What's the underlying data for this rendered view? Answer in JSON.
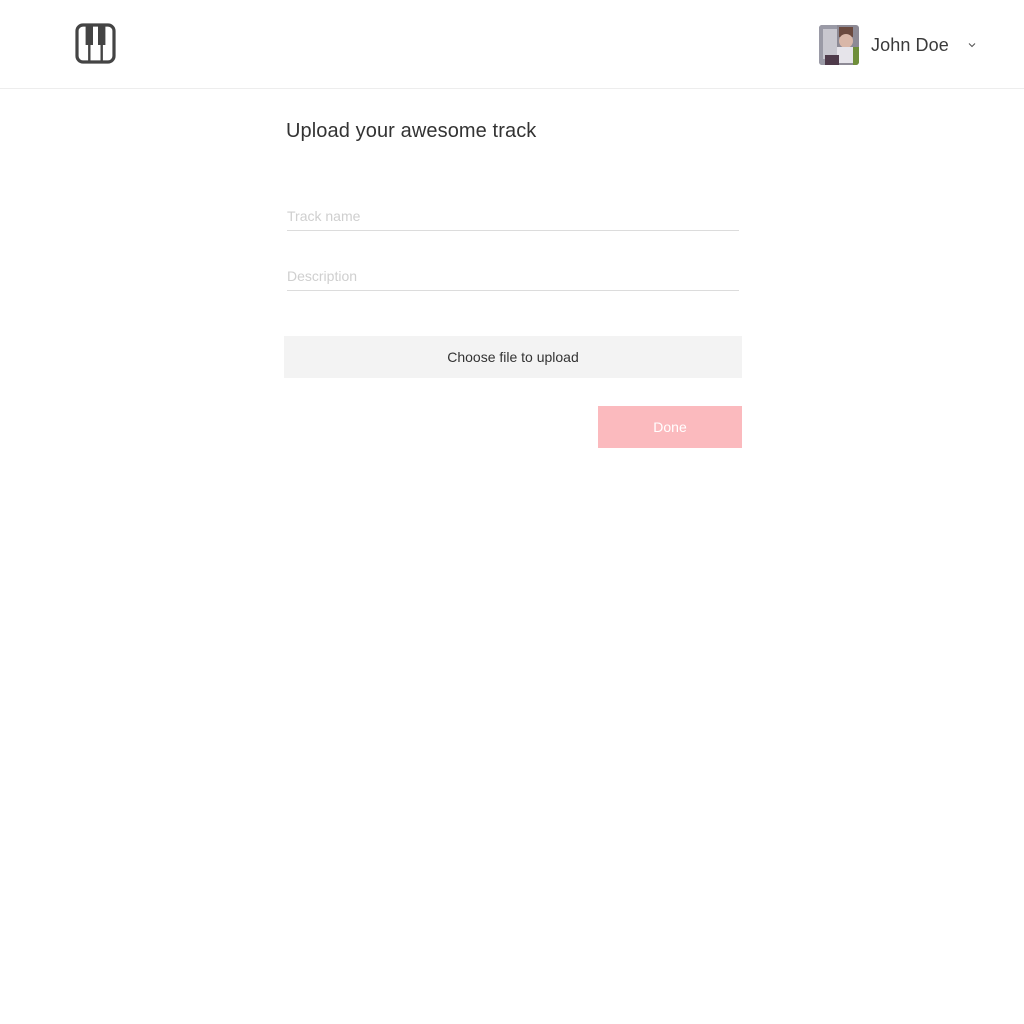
{
  "header": {
    "logo_icon": "piano-keys-icon",
    "user": {
      "name": "John Doe",
      "avatar_icon": "user-avatar-photo",
      "menu_icon": "chevron-down-icon"
    }
  },
  "main": {
    "title": "Upload your awesome track",
    "track_name": {
      "value": "",
      "placeholder": "Track name"
    },
    "description": {
      "value": "",
      "placeholder": "Description"
    },
    "upload_label": "Choose file to upload",
    "done_label": "Done"
  },
  "colors": {
    "accent": "#fbbabe",
    "upload_bg": "#f3f3f3",
    "text": "#333333",
    "placeholder": "#cfcfcf",
    "border": "#dcdcdc"
  }
}
